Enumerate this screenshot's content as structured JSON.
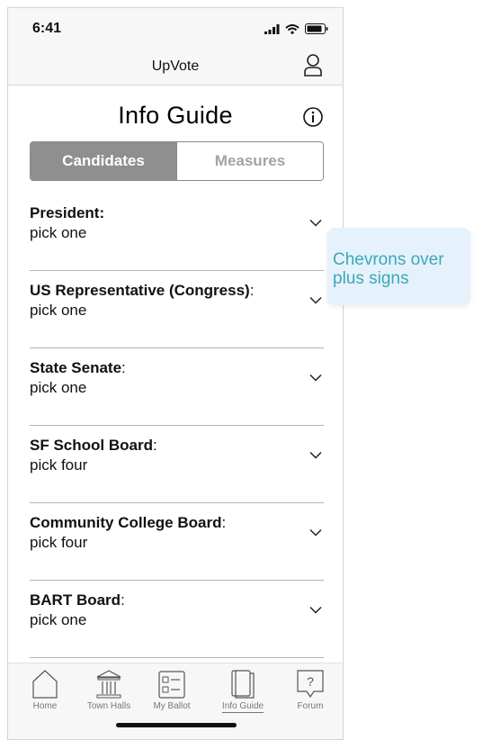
{
  "status": {
    "time": "6:41"
  },
  "header": {
    "app_title": "UpVote"
  },
  "page": {
    "title": "Info Guide",
    "tabs": [
      {
        "label": "Candidates",
        "active": true
      },
      {
        "label": "Measures",
        "active": false
      }
    ]
  },
  "races": [
    {
      "name": "President:",
      "suffix": "",
      "detail": "pick one"
    },
    {
      "name": "US Representative (Congress)",
      "suffix": ":",
      "detail": "pick one"
    },
    {
      "name": "State Senate",
      "suffix": ":",
      "detail": "pick one"
    },
    {
      "name": "SF School Board",
      "suffix": ":",
      "detail": "pick four"
    },
    {
      "name": "Community College Board",
      "suffix": ":",
      "detail": "pick four"
    },
    {
      "name": "BART Board",
      "suffix": ":",
      "detail": "pick one"
    }
  ],
  "tabbar": {
    "items": [
      {
        "label": "Home",
        "icon": "home-icon"
      },
      {
        "label": "Town Halls",
        "icon": "town-hall-icon"
      },
      {
        "label": "My Ballot",
        "icon": "ballot-icon"
      },
      {
        "label": "Info Guide",
        "icon": "book-icon",
        "active": true
      },
      {
        "label": "Forum",
        "icon": "forum-icon"
      }
    ]
  },
  "annotation": {
    "text": "Chevrons over plus signs"
  },
  "colors": {
    "segment_active": "#8f8f8f",
    "annotation_bg": "#e6f2fb",
    "annotation_text": "#3aa9b7"
  }
}
